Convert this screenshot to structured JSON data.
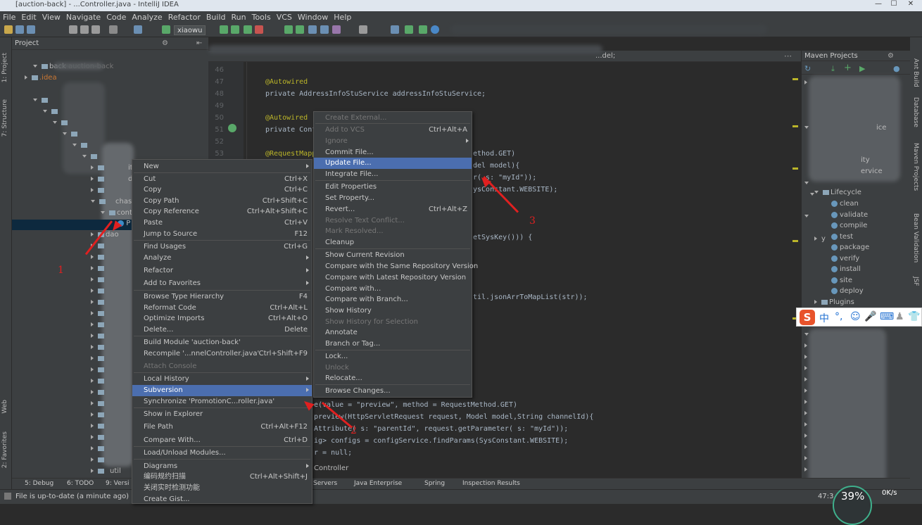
{
  "window": {
    "title": "[auction-back] - ...Controller.java - IntelliJ IDEA"
  },
  "menu": [
    "File",
    "Edit",
    "View",
    "Navigate",
    "Code",
    "Analyze",
    "Refactor",
    "Build",
    "Run",
    "Tools",
    "VCS",
    "Window",
    "Help"
  ],
  "toolbar": {
    "run_config": "xiaowu"
  },
  "left_strip": {
    "project": "1: Project",
    "structure": "7: Structure",
    "web": "Web",
    "favorites": "2: Favorites"
  },
  "project": {
    "header": "Project",
    "root": "back",
    "root_path": "auction-back",
    "idea": ".idea",
    "rows": [
      "ity",
      "dls",
      "rl",
      "chase",
      "cont",
      "P",
      "dao",
      "u",
      "util"
    ]
  },
  "gutter_lines": [
    "46",
    "47",
    "48",
    "49",
    "50",
    "51",
    "52",
    "53"
  ],
  "editor": {
    "tab": "...del;",
    "lines": [
      {
        "t": "@Autowired",
        "c": "an"
      },
      {
        "t": "private AddressInfoStuService addressInfoStuService;",
        "c": ""
      },
      {
        "t": "@Autowired",
        "c": "an"
      },
      {
        "t": "private Confi",
        "c": ""
      },
      {
        "t": "@RequestMapp",
        "c": "an"
      }
    ],
    "right_frag": [
      "ethod.GET)",
      "del model){",
      "r( s: \"myId\"));",
      "ysConstant.WEBSITE);",
      "etSysKey())) {",
      "til.jsonArrToMapList(str));"
    ],
    "lower": [
      "e(value = \"preview\", method = RequestMethod.GET)",
      "preview(HttpServletRequest request, Model model,String channelId){",
      "Attribute( s: \"parentId\", request.getParameter( s: \"myId\"));",
      "ig> configs = configService.findParams(SysConstant.WEBSITE);",
      "r = null;",
      "Controller"
    ]
  },
  "context_menu": [
    {
      "label": "New",
      "shortcut": "",
      "sub": true
    },
    {
      "label": "Cut",
      "shortcut": "Ctrl+X"
    },
    {
      "label": "Copy",
      "shortcut": "Ctrl+C"
    },
    {
      "label": "Copy Path",
      "shortcut": "Ctrl+Shift+C"
    },
    {
      "label": "Copy Reference",
      "shortcut": "Ctrl+Alt+Shift+C"
    },
    {
      "label": "Paste",
      "shortcut": "Ctrl+V"
    },
    {
      "label": "Jump to Source",
      "shortcut": "F12"
    },
    {
      "label": "Find Usages",
      "shortcut": "Ctrl+G"
    },
    {
      "label": "Analyze",
      "shortcut": "",
      "sub": true
    },
    {
      "label": "Refactor",
      "shortcut": "",
      "sub": true
    },
    {
      "label": "Add to Favorites",
      "shortcut": "",
      "sub": true
    },
    {
      "label": "Browse Type Hierarchy",
      "shortcut": "F4"
    },
    {
      "label": "Reformat Code",
      "shortcut": "Ctrl+Alt+L"
    },
    {
      "label": "Optimize Imports",
      "shortcut": "Ctrl+Alt+O"
    },
    {
      "label": "Delete...",
      "shortcut": "Delete"
    },
    {
      "label": "Build Module 'auction-back'",
      "shortcut": ""
    },
    {
      "label": "Recompile '...nnelController.java'",
      "shortcut": "Ctrl+Shift+F9"
    },
    {
      "label": "Attach Console",
      "shortcut": "",
      "dis": true
    },
    {
      "label": "Local History",
      "shortcut": "",
      "sub": true
    },
    {
      "label": "Subversion",
      "shortcut": "",
      "sub": true,
      "sel": true
    },
    {
      "label": "Synchronize 'PromotionC...roller.java'",
      "shortcut": ""
    },
    {
      "label": "Show in Explorer",
      "shortcut": ""
    },
    {
      "label": "File Path",
      "shortcut": "Ctrl+Alt+F12"
    },
    {
      "label": "Compare With...",
      "shortcut": "Ctrl+D"
    },
    {
      "label": "Load/Unload Modules...",
      "shortcut": ""
    },
    {
      "label": "Diagrams",
      "shortcut": "",
      "sub": true
    },
    {
      "label": "编码规约扫描",
      "shortcut": "Ctrl+Alt+Shift+J"
    },
    {
      "label": "关闭实时检测功能",
      "shortcut": ""
    },
    {
      "label": "Create Gist...",
      "shortcut": ""
    }
  ],
  "svn_menu": [
    {
      "label": "Create External...",
      "dis": true
    },
    {
      "label": "Add to VCS",
      "shortcut": "Ctrl+Alt+A",
      "dis": true
    },
    {
      "label": "Ignore",
      "dis": true,
      "sub": true
    },
    {
      "label": "Commit File..."
    },
    {
      "label": "Update File...",
      "sel": true
    },
    {
      "label": "Integrate File..."
    },
    {
      "label": "Edit Properties"
    },
    {
      "label": "Set Property..."
    },
    {
      "label": "Revert...",
      "shortcut": "Ctrl+Alt+Z"
    },
    {
      "label": "Resolve Text Conflict...",
      "dis": true
    },
    {
      "label": "Mark Resolved...",
      "dis": true
    },
    {
      "label": "Cleanup"
    },
    {
      "label": "Show Current Revision"
    },
    {
      "label": "Compare with the Same Repository Version"
    },
    {
      "label": "Compare with Latest Repository Version"
    },
    {
      "label": "Compare with..."
    },
    {
      "label": "Compare with Branch..."
    },
    {
      "label": "Show History"
    },
    {
      "label": "Show History for Selection",
      "dis": true
    },
    {
      "label": "Annotate"
    },
    {
      "label": "Branch or Tag..."
    },
    {
      "label": "Lock..."
    },
    {
      "label": "Unlock",
      "dis": true
    },
    {
      "label": "Relocate..."
    },
    {
      "label": "Browse Changes..."
    }
  ],
  "maven": {
    "header": "Maven Projects",
    "lifecycle": "Lifecycle",
    "goals": [
      "clean",
      "validate",
      "compile",
      "test",
      "package",
      "verify",
      "install",
      "site",
      "deploy"
    ],
    "plugins": "Plugins",
    "frag": [
      "ice",
      "y",
      "ity",
      "ervice"
    ]
  },
  "right_strip": [
    "Ant Build",
    "Database",
    "Maven Projects",
    "Bean Validation",
    "JSF"
  ],
  "bottom_tabs": [
    "5: Debug",
    "6: TODO",
    "9: Versi",
    "Servers",
    "Java Enterprise",
    "Spring",
    "Inspection Results"
  ],
  "status": {
    "message": "File is up-to-date (a minute ago)",
    "pos": "47:3",
    "percent": "39%",
    "speed": "0K/s"
  },
  "ime": {
    "zh": "中"
  },
  "annotations": [
    "1",
    "2",
    "3"
  ],
  "colors": {
    "accent": "#4b6eaf",
    "red": "#e02020"
  }
}
